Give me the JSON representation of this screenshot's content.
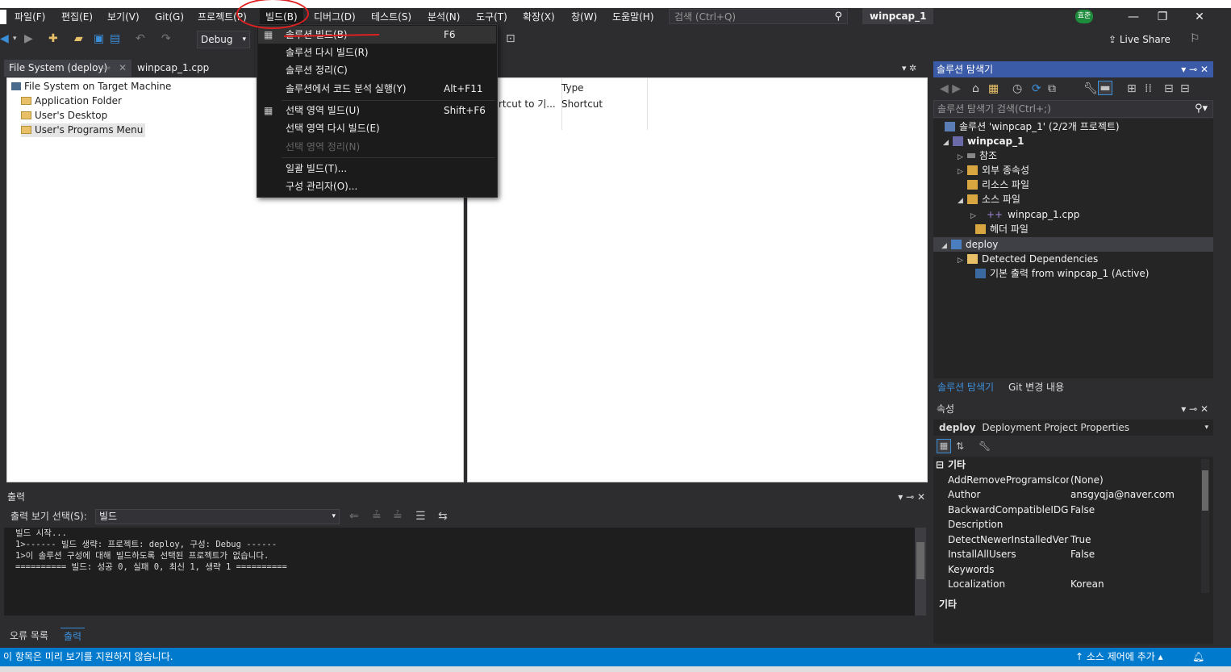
{
  "menubar": {
    "items": [
      "파일(F)",
      "편집(E)",
      "보기(V)",
      "Git(G)",
      "프로젝트(P)",
      "빌드(B)",
      "디버그(D)",
      "테스트(S)",
      "분석(N)",
      "도구(T)",
      "확장(X)",
      "창(W)",
      "도움말(H)"
    ],
    "search_placeholder": "검색 (Ctrl+Q)",
    "solution_name": "winpcap_1",
    "user_initials": "효준"
  },
  "toolbar": {
    "config": "Debug",
    "live_share": "Live Share"
  },
  "tabs": {
    "active": "File System (deploy)",
    "second": "winpcap_1.cpp"
  },
  "filesystem": {
    "root": "File System on Target Machine",
    "items": [
      "Application Folder",
      "User's Desktop",
      "User's Programs Menu"
    ],
    "columns": {
      "name_partial": "rtcut to 기...",
      "type_header": "Type",
      "type_value": "Shortcut"
    }
  },
  "build_menu": {
    "items": [
      {
        "label": "솔루션 빌드(B)",
        "shortcut": "F6"
      },
      {
        "label": "솔루션 다시 빌드(R)",
        "shortcut": ""
      },
      {
        "label": "솔루션 정리(C)",
        "shortcut": ""
      },
      {
        "label": "솔루션에서 코드 분석 실행(Y)",
        "shortcut": "Alt+F11"
      },
      {
        "label": "선택 영역 빌드(U)",
        "shortcut": "Shift+F6"
      },
      {
        "label": "선택 영역 다시 빌드(E)",
        "shortcut": ""
      },
      {
        "label": "선택 영역 정리(N)",
        "shortcut": ""
      },
      {
        "label": "일괄 빌드(T)...",
        "shortcut": ""
      },
      {
        "label": "구성 관리자(O)...",
        "shortcut": ""
      }
    ]
  },
  "solution_explorer": {
    "title": "솔루션 탐색기",
    "search_placeholder": "솔루션 탐색기 검색(Ctrl+;)",
    "tree": [
      "솔루션 'winpcap_1' (2/2개 프로젝트)",
      "winpcap_1",
      "참조",
      "외부 종속성",
      "리소스 파일",
      "소스 파일",
      "winpcap_1.cpp",
      "헤더 파일",
      "deploy",
      "Detected Dependencies",
      "기본 출력 from winpcap_1 (Active)"
    ],
    "tabs": [
      "솔루션 탐색기",
      "Git 변경 내용"
    ]
  },
  "properties": {
    "title": "속성",
    "object_name": "deploy",
    "object_type": "Deployment Project Properties",
    "category": "기타",
    "rows": [
      {
        "name": "AddRemoveProgramsIcon",
        "value": "(None)"
      },
      {
        "name": "Author",
        "value": "ansgyqja@naver.com"
      },
      {
        "name": "BackwardCompatibleIDGenerator",
        "value": "False"
      },
      {
        "name": "Description",
        "value": ""
      },
      {
        "name": "DetectNewerInstalledVersion",
        "value": "True"
      },
      {
        "name": "InstallAllUsers",
        "value": "False"
      },
      {
        "name": "Keywords",
        "value": ""
      },
      {
        "name": "Localization",
        "value": "Korean"
      }
    ],
    "description_title": "기타"
  },
  "output": {
    "title": "출력",
    "show_label": "출력 보기 선택(S):",
    "source": "빌드",
    "lines": [
      "빌드 시작...",
      "1>------ 빌드 생략: 프로젝트: deploy, 구성: Debug ------",
      "1>이 솔루션 구성에 대해 빌드하도록 선택된 프로젝트가 없습니다.",
      "========== 빌드: 성공 0, 실패 0, 최신 1, 생략 1 =========="
    ],
    "tabs": [
      "오류 목록",
      "출력"
    ]
  },
  "statusbar": {
    "message": "이 항목은 미리 보기를 지원하지 않습니다.",
    "source_control": "↑ 소스 제어에 추가 ▴"
  }
}
